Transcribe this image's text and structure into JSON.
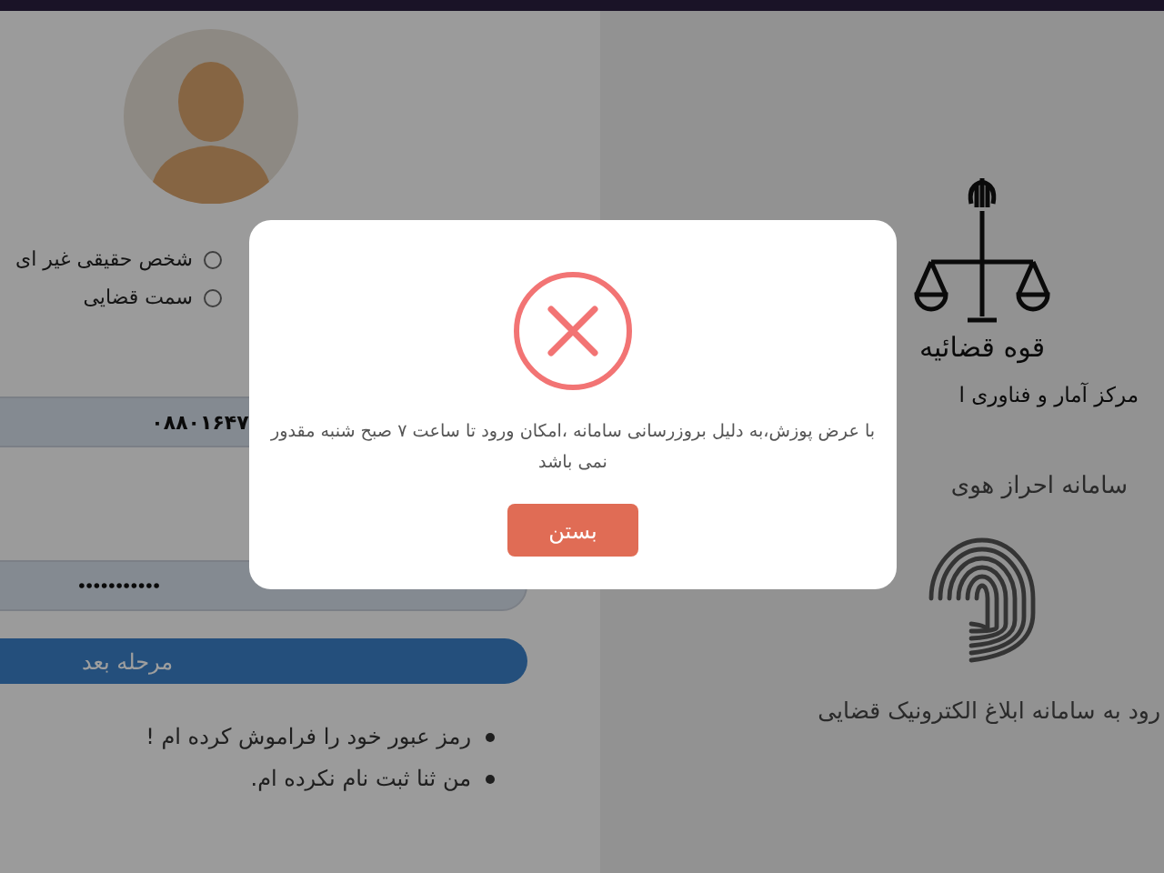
{
  "login_panel": {
    "user_types": [
      {
        "label": "شخص حقیقی غیر ای",
        "selected": false
      },
      {
        "label": "سمت قضایی",
        "selected": false
      }
    ],
    "username_field": {
      "value": "۰۸۸۰۱۶۴۷"
    },
    "password_field": {
      "value": "•••••••••••"
    },
    "next_button": "مرحله بعد",
    "links": [
      "رمز عبور خود را فراموش کرده ام !",
      "من ثنا ثبت نام نکرده ام."
    ]
  },
  "brand_panel": {
    "organization": "قوه قضائیه",
    "center": "مرکز آمار و فناوری ا",
    "system": "سامانه احراز هوی",
    "caption": "رود به سامانه ابلاغ الکترونیک قضایی"
  },
  "dialog": {
    "message": "با عرض پوزش،به دلیل بروزرسانی سامانه ،امکان ورود تا ساعت ۷ صبح شنبه مقدور نمی باشد",
    "close_button": "بستن"
  }
}
